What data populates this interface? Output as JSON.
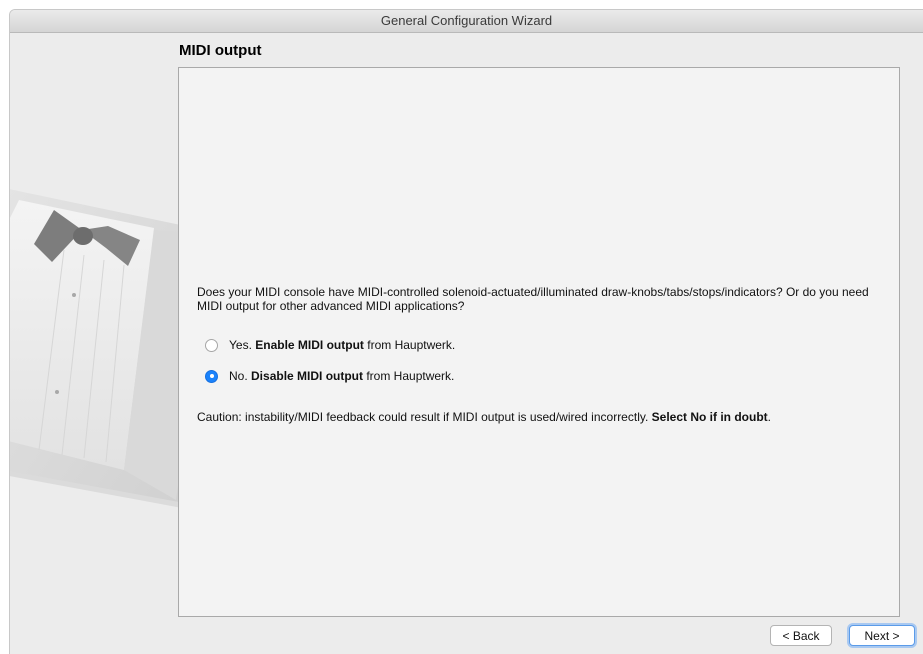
{
  "window": {
    "title": "General Configuration Wizard"
  },
  "page": {
    "heading": "MIDI output",
    "question": "Does your MIDI console have MIDI-controlled solenoid-actuated/illuminated draw-knobs/tabs/stops/indicators? Or do you need MIDI output for other advanced MIDI applications?",
    "options": [
      {
        "prefix": "Yes. ",
        "bold": "Enable MIDI output",
        "suffix": " from Hauptwerk.",
        "selected": false
      },
      {
        "prefix": "No. ",
        "bold": "Disable MIDI output",
        "suffix": " from Hauptwerk.",
        "selected": true
      }
    ],
    "caution": {
      "text": "Caution: instability/MIDI feedback could result if MIDI output is used/wired incorrectly. ",
      "bold": "Select No if in doubt",
      "end": "."
    }
  },
  "footer": {
    "back_label": "< Back",
    "next_label": "Next >"
  },
  "colors": {
    "accent": "#1a82fb",
    "window_bg": "#ececec",
    "content_bg": "#f3f3f3"
  }
}
